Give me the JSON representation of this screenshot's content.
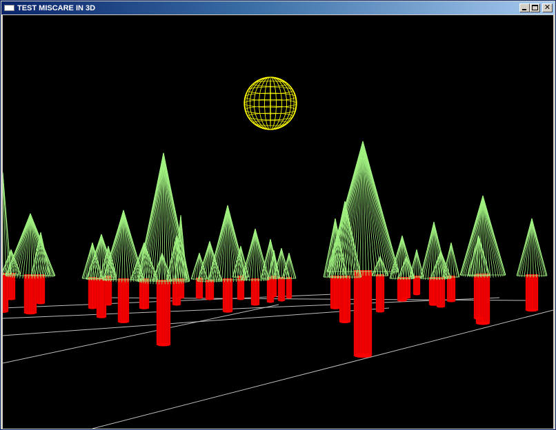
{
  "window": {
    "title": "TEST MISCARE IN 3D",
    "controls": {
      "minimize": "minimize",
      "maximize": "maximize",
      "close": "close"
    }
  },
  "scene": {
    "background": "#000000",
    "foliage_color": "#a0f080",
    "trunk_color": "#ff0000",
    "sun_color": "#ffff00",
    "ground_grid_color": "#bfbfbf"
  }
}
